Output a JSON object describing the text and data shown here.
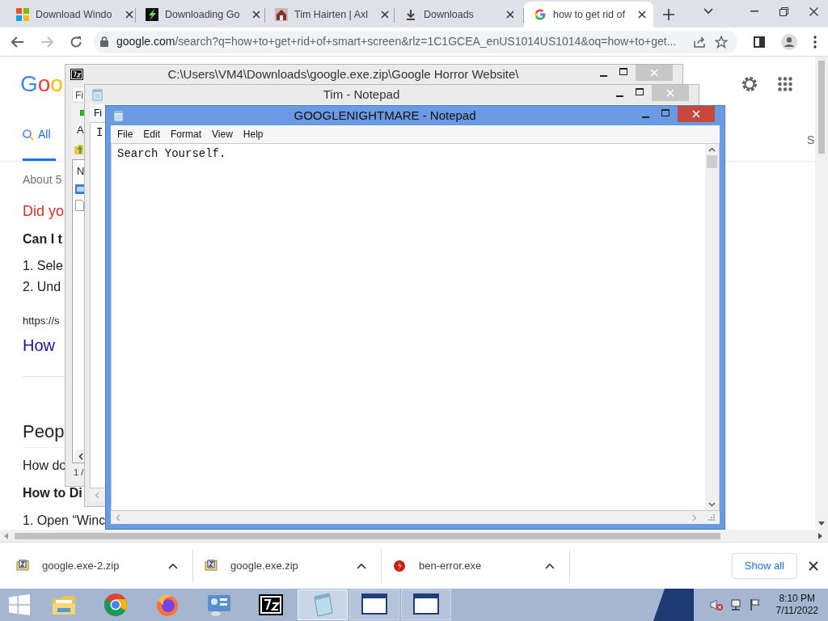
{
  "browser": {
    "tabs": [
      {
        "title": "Download Windo",
        "selected": false
      },
      {
        "title": "Downloading Go",
        "selected": false
      },
      {
        "title": "Tim Hairten | Axl",
        "selected": false
      },
      {
        "title": "Downloads",
        "selected": false
      },
      {
        "title": "how to get rid of",
        "selected": true
      }
    ],
    "url_host": "google.com",
    "url_rest": "/search?q=how+to+get+rid+of+smart+screen&rlz=1C1GCEA_enUS1014US1014&oq=how+to+get..."
  },
  "page": {
    "logo": "Goo",
    "nav_tabs": [
      {
        "label": "All",
        "selected": true
      }
    ],
    "right_tab": "S",
    "results": [
      {
        "kind": "count",
        "text": "About 5"
      },
      {
        "kind": "suggestion",
        "text": "Did yo"
      },
      {
        "kind": "heading",
        "text": "Can I t"
      },
      {
        "kind": "list",
        "items": [
          "1. Sele",
          "2. Und"
        ]
      },
      {
        "kind": "url",
        "text": "https://s"
      },
      {
        "kind": "link",
        "text": "How"
      },
      {
        "kind": "section",
        "text": "Peop"
      },
      {
        "kind": "question",
        "text": "How do"
      },
      {
        "kind": "heading",
        "text": "How to Di"
      },
      {
        "kind": "list",
        "items": [
          "1. Open “Winc"
        ]
      }
    ]
  },
  "windows": [
    {
      "kind": "archive",
      "title": "C:\\Users\\VM4\\Downloads\\google.exe.zip\\Google Horror Website\\",
      "active": false,
      "menu": "Fi",
      "toolbar": "A",
      "column": "N",
      "status": "1 /"
    },
    {
      "kind": "notepad",
      "title": "Tim - Notepad",
      "active": false,
      "menu": [
        "Fi"
      ],
      "text": "I"
    },
    {
      "kind": "notepad",
      "title": "GOOGLENIGHTMARE - Notepad",
      "active": true,
      "menu": [
        "File",
        "Edit",
        "Format",
        "View",
        "Help"
      ],
      "text": "Search Yourself."
    }
  ],
  "downloads": {
    "items": [
      {
        "name": "google.exe-2.zip",
        "kind": "zip"
      },
      {
        "name": "google.exe.zip",
        "kind": "zip"
      },
      {
        "name": "ben-error.exe",
        "kind": "exe"
      }
    ],
    "show_all": "Show all"
  },
  "taskbar": {
    "apps": [
      {
        "kind": "folder",
        "active": false
      },
      {
        "kind": "chrome",
        "active": false
      },
      {
        "kind": "firefox",
        "active": false
      },
      {
        "kind": "control",
        "active": false
      },
      {
        "kind": "sevenzip",
        "active": false
      },
      {
        "kind": "notepad",
        "active": true
      },
      {
        "kind": "window",
        "active": false
      },
      {
        "kind": "window",
        "active": false
      }
    ],
    "time": "8:10 PM",
    "date": "7/11/2022"
  }
}
